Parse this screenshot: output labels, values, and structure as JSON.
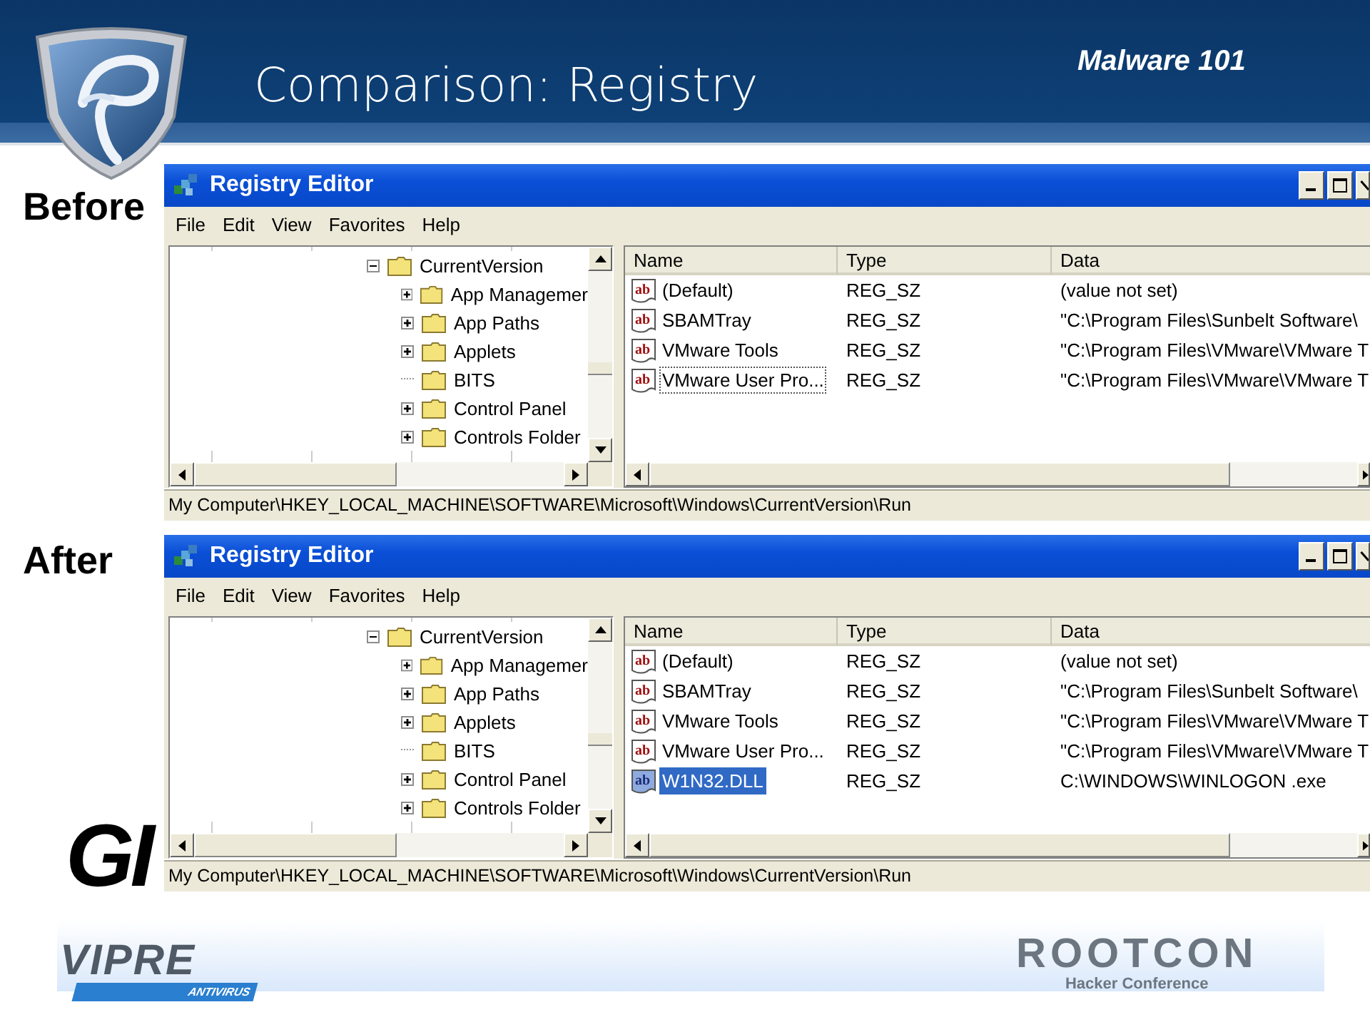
{
  "slide": {
    "title": "Comparison: Registry",
    "tag": "Malware 101"
  },
  "panels": [
    {
      "label": "Before",
      "window": {
        "title": "Registry Editor",
        "menu": [
          {
            "label": "File"
          },
          {
            "label": "Edit"
          },
          {
            "label": "View"
          },
          {
            "label": "Favorites"
          },
          {
            "label": "Help"
          }
        ],
        "tree": {
          "name": "CurrentVersion",
          "expanded": true,
          "children": [
            {
              "name": "App Managemer",
              "kind": "branch",
              "expanded": false
            },
            {
              "name": "App Paths",
              "kind": "branch",
              "expanded": false
            },
            {
              "name": "Applets",
              "kind": "branch",
              "expanded": false
            },
            {
              "name": "BITS",
              "kind": "leaf"
            },
            {
              "name": "Control Panel",
              "kind": "branch",
              "expanded": false
            },
            {
              "name": "Controls Folder",
              "kind": "branch",
              "expanded": false
            }
          ]
        },
        "columns": [
          "Name",
          "Type",
          "Data"
        ],
        "rows": [
          {
            "icon": "ab",
            "name": "(Default)",
            "type": "REG_SZ",
            "data": "(value not set)",
            "selected": false,
            "focused": false
          },
          {
            "icon": "ab",
            "name": "SBAMTray",
            "type": "REG_SZ",
            "data": "\"C:\\Program Files\\Sunbelt Software\\",
            "selected": false,
            "focused": false
          },
          {
            "icon": "ab",
            "name": "VMware Tools",
            "type": "REG_SZ",
            "data": "\"C:\\Program Files\\VMware\\VMware T",
            "selected": false,
            "focused": false
          },
          {
            "icon": "ab",
            "name": "VMware User Pro...",
            "type": "REG_SZ",
            "data": "\"C:\\Program Files\\VMware\\VMware T",
            "selected": false,
            "focused": true
          }
        ],
        "status": "My Computer\\HKEY_LOCAL_MACHINE\\SOFTWARE\\Microsoft\\Windows\\CurrentVersion\\Run"
      }
    },
    {
      "label": "After",
      "window": {
        "title": "Registry Editor",
        "menu": [
          {
            "label": "File"
          },
          {
            "label": "Edit"
          },
          {
            "label": "View"
          },
          {
            "label": "Favorites"
          },
          {
            "label": "Help"
          }
        ],
        "tree": {
          "name": "CurrentVersion",
          "expanded": true,
          "children": [
            {
              "name": "App Managemer",
              "kind": "branch",
              "expanded": false
            },
            {
              "name": "App Paths",
              "kind": "branch",
              "expanded": false
            },
            {
              "name": "Applets",
              "kind": "branch",
              "expanded": false
            },
            {
              "name": "BITS",
              "kind": "leaf"
            },
            {
              "name": "Control Panel",
              "kind": "branch",
              "expanded": false
            },
            {
              "name": "Controls Folder",
              "kind": "branch",
              "expanded": false
            }
          ]
        },
        "columns": [
          "Name",
          "Type",
          "Data"
        ],
        "rows": [
          {
            "icon": "ab",
            "name": "(Default)",
            "type": "REG_SZ",
            "data": "(value not set)",
            "selected": false,
            "focused": false
          },
          {
            "icon": "ab",
            "name": "SBAMTray",
            "type": "REG_SZ",
            "data": "\"C:\\Program Files\\Sunbelt Software\\",
            "selected": false,
            "focused": false
          },
          {
            "icon": "ab",
            "name": "VMware Tools",
            "type": "REG_SZ",
            "data": "\"C:\\Program Files\\VMware\\VMware T",
            "selected": false,
            "focused": false
          },
          {
            "icon": "ab",
            "name": "VMware User Pro...",
            "type": "REG_SZ",
            "data": "\"C:\\Program Files\\VMware\\VMware T",
            "selected": false,
            "focused": false
          },
          {
            "icon": "ab",
            "name": "W1N32.DLL",
            "type": "REG_SZ",
            "data": "C:\\WINDOWS\\WINLOGON .exe",
            "selected": true,
            "focused": false
          }
        ],
        "status": "My Computer\\HKEY_LOCAL_MACHINE\\SOFTWARE\\Microsoft\\Windows\\CurrentVersion\\Run"
      }
    }
  ],
  "footer": {
    "cut_logo": "GI",
    "vipre": "VIPRE",
    "vipre_sub": "ANTIVIRUS",
    "rootcon": "ROOTCON",
    "rootcon_sub": "Hacker Conference"
  }
}
